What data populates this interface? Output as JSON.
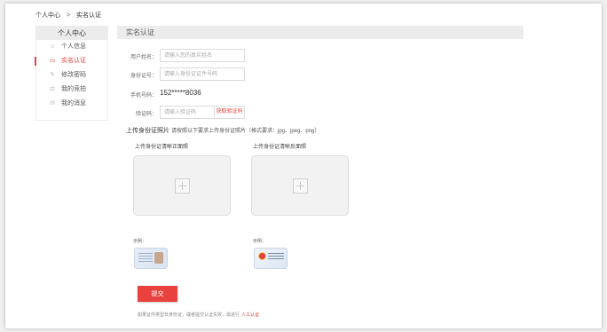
{
  "breadcrumb": {
    "home": "个人中心",
    "separator": ">",
    "current": "实名认证"
  },
  "sidebar": {
    "title": "个人中心",
    "items": [
      {
        "label": "个人信息",
        "icon": "user-icon",
        "glyph": "☺",
        "active": false
      },
      {
        "label": "实名认证",
        "icon": "id-card-icon",
        "glyph": "▭",
        "active": true
      },
      {
        "label": "修改密码",
        "icon": "edit-icon",
        "glyph": "✎",
        "active": false
      },
      {
        "label": "我的竞拍",
        "icon": "auction-icon",
        "glyph": "⚖",
        "active": false
      },
      {
        "label": "我的消息",
        "icon": "message-icon",
        "glyph": "✉",
        "active": false
      }
    ]
  },
  "main": {
    "title": "实名认证",
    "fields": {
      "name": {
        "label": "用户姓名：",
        "placeholder": "请输入您的真实姓名"
      },
      "id_number": {
        "label": "身份证号：",
        "placeholder": "请输入身份证证件号码"
      },
      "phone": {
        "label": "手机号码：",
        "value": "152*****8036"
      },
      "code": {
        "label": "验证码：",
        "placeholder": "请输入验证码",
        "button": "获取验证码"
      }
    },
    "upload": {
      "title": "上传身份证照片",
      "requirement": "请按照以下要求上传身份证照片（格式要求：jpg、jpeg、png）",
      "front_label": "上传身份证清晰正面照",
      "back_label": "上传身份证清晰反面照",
      "example_label": "示例："
    },
    "submit_label": "提交",
    "note_text": "如果证件类型非身份证，或者提交认证失败，需进行",
    "note_link": "人工认证"
  },
  "colors": {
    "accent": "#e8413e",
    "panel": "#ececec"
  }
}
